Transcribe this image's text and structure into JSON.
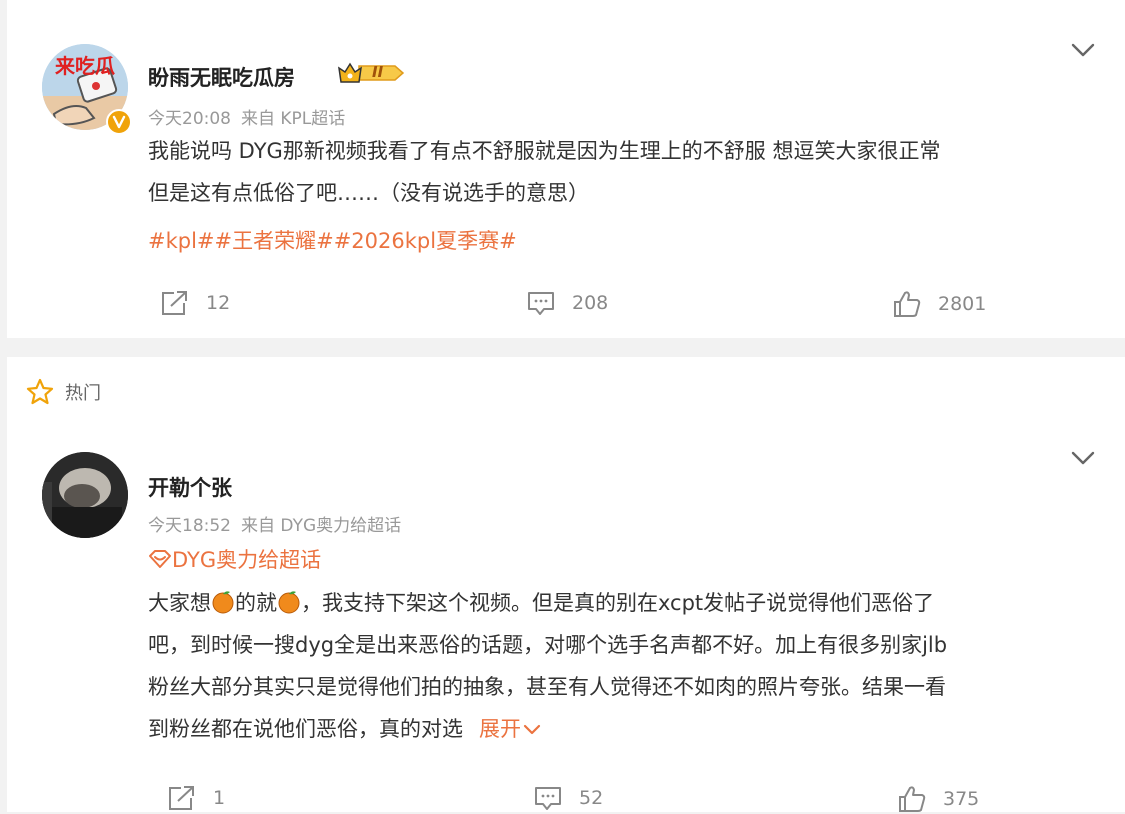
{
  "post": {
    "username": "盼雨无眠吃瓜房",
    "avatar_text": "来吃瓜",
    "level_badge": "II",
    "time": "今天20:08",
    "source": "来自 KPL超话",
    "text_lines": [
      "我能说吗 DYG那新视频我看了有点不舒服就是因为生理上的不舒服 想逗笑大家很正常",
      "但是这有点低俗了吧……（没有说选手的意思）"
    ],
    "tags": "#kpl##王者荣耀##2026kpl夏季赛#",
    "reposts": "12",
    "comments": "208",
    "likes": "2801"
  },
  "section": {
    "label": "热门"
  },
  "comment": {
    "username": "开勒个张",
    "time": "今天18:52",
    "source": "来自 DYG奥力给超话",
    "topic": "DYG奥力给超话",
    "line1_a": "大家想",
    "line1_b": "的就",
    "line1_c": "，我支持下架这个视频。但是真的别在xcpt发帖子说觉得他们恶俗了",
    "line2": "吧，到时候一搜dyg全是出来恶俗的话题，对哪个选手名声都不好。加上有很多别家jlb",
    "line3": "粉丝大部分其实只是觉得他们拍的抽象，甚至有人觉得还不如肉的照片夸张。结果一看",
    "line4": "到粉丝都在说他们恶俗，真的对选",
    "expand": "展开",
    "reposts": "1",
    "comments": "52",
    "likes": "375"
  },
  "colors": {
    "accent": "#eb7340",
    "muted": "#999999",
    "background": "#f2f2f2"
  },
  "icons": [
    "chevron-down-icon",
    "share-icon",
    "comment-icon",
    "like-icon",
    "star-icon",
    "verified-badge-icon",
    "supertopic-icon",
    "orange-emoji"
  ]
}
